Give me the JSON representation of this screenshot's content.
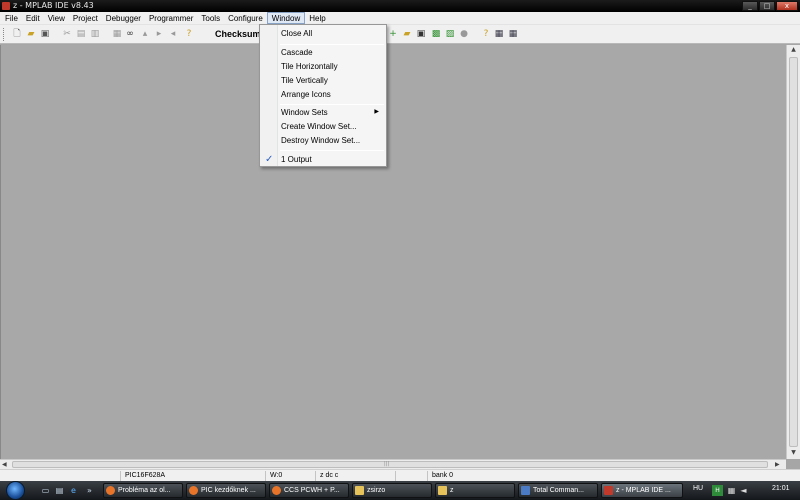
{
  "window": {
    "title": "z - MPLAB IDE v8.43"
  },
  "menubar": [
    "File",
    "Edit",
    "View",
    "Project",
    "Debugger",
    "Programmer",
    "Tools",
    "Configure",
    "Window",
    "Help"
  ],
  "toolbar": {
    "checksum_label": "Checksum:"
  },
  "window_menu": {
    "close_all": "Close All",
    "cascade": "Cascade",
    "tile_h": "Tile Horizontally",
    "tile_v": "Tile Vertically",
    "arrange": "Arrange Icons",
    "window_sets": "Window Sets",
    "create_set": "Create Window Set...",
    "destroy_set": "Destroy Window Set...",
    "output": "1 Output"
  },
  "status": {
    "device": "PIC16F628A",
    "w": "W:0",
    "flags": "z dc c",
    "bank": "bank 0"
  },
  "taskbar": {
    "tasks": [
      "Probléma az ol...",
      "PIC kezdőknek ...",
      "CCS PCWH + P...",
      "zsirzo",
      "z",
      "Total Comman...",
      "z - MPLAB IDE ..."
    ],
    "lang": "HU",
    "clock": "21:01"
  },
  "colors": {
    "accent": "#2c5fc0",
    "workspace": "#a8a8a8"
  }
}
